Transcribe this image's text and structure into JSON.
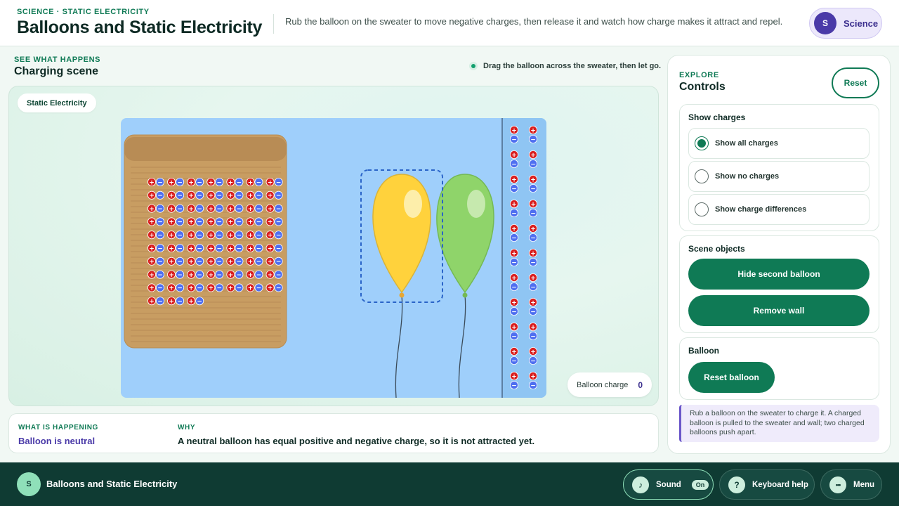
{
  "header": {
    "eyebrow": "SCIENCE · STATIC ELECTRICITY",
    "title": "Balloons and Static Electricity",
    "description": "Rub the balloon on the sweater to move negative charges, then release it and watch how charge makes it attract and repel.",
    "subject_avatar": "S",
    "subject_label": "Science"
  },
  "scene": {
    "eyebrow": "SEE WHAT HAPPENS",
    "title": "Charging scene",
    "hint": "Drag the balloon across the sweater, then let go.",
    "tag": "Static Electricity",
    "balloon_charge_label": "Balloon charge",
    "balloon_charge_value": "0",
    "sweater_charge_rows": [
      7,
      7,
      7,
      7,
      7,
      7,
      7,
      7,
      7,
      3
    ],
    "wall_charge_rows": 11,
    "charge_symbols": {
      "positive": "+",
      "negative": "−"
    },
    "colors": {
      "sky": "#9fcffb",
      "sweater": "#c89d62",
      "balloon_yellow": "#ffd23c",
      "balloon_green": "#8fd46a",
      "positive": "#d91e1e",
      "negative": "#4f6ff0"
    }
  },
  "info": {
    "status_label": "WHAT IS HAPPENING",
    "status_value": "Balloon is neutral",
    "why_label": "WHY",
    "why_value": "A neutral balloon has equal positive and negative charge, so it is not attracted yet."
  },
  "controls": {
    "eyebrow": "EXPLORE",
    "title": "Controls",
    "reset_label": "Reset",
    "show_charges": {
      "title": "Show charges",
      "options": [
        "Show all charges",
        "Show no charges",
        "Show charge differences"
      ],
      "selected": "Show all charges"
    },
    "scene_objects": {
      "title": "Scene objects",
      "hide_second_balloon": "Hide second balloon",
      "remove_wall": "Remove wall"
    },
    "balloon": {
      "title": "Balloon",
      "reset_balloon": "Reset balloon"
    },
    "note": "Rub a balloon on the sweater to charge it. A charged balloon is pulled to the sweater and wall; two charged balloons push apart."
  },
  "footer": {
    "avatar": "S",
    "title": "Balloons and Static Electricity",
    "sound_icon": "♪",
    "sound_label": "Sound",
    "sound_state": "On",
    "help_icon": "?",
    "help_label": "Keyboard help",
    "menu_icon": "•••",
    "menu_label": "Menu"
  }
}
